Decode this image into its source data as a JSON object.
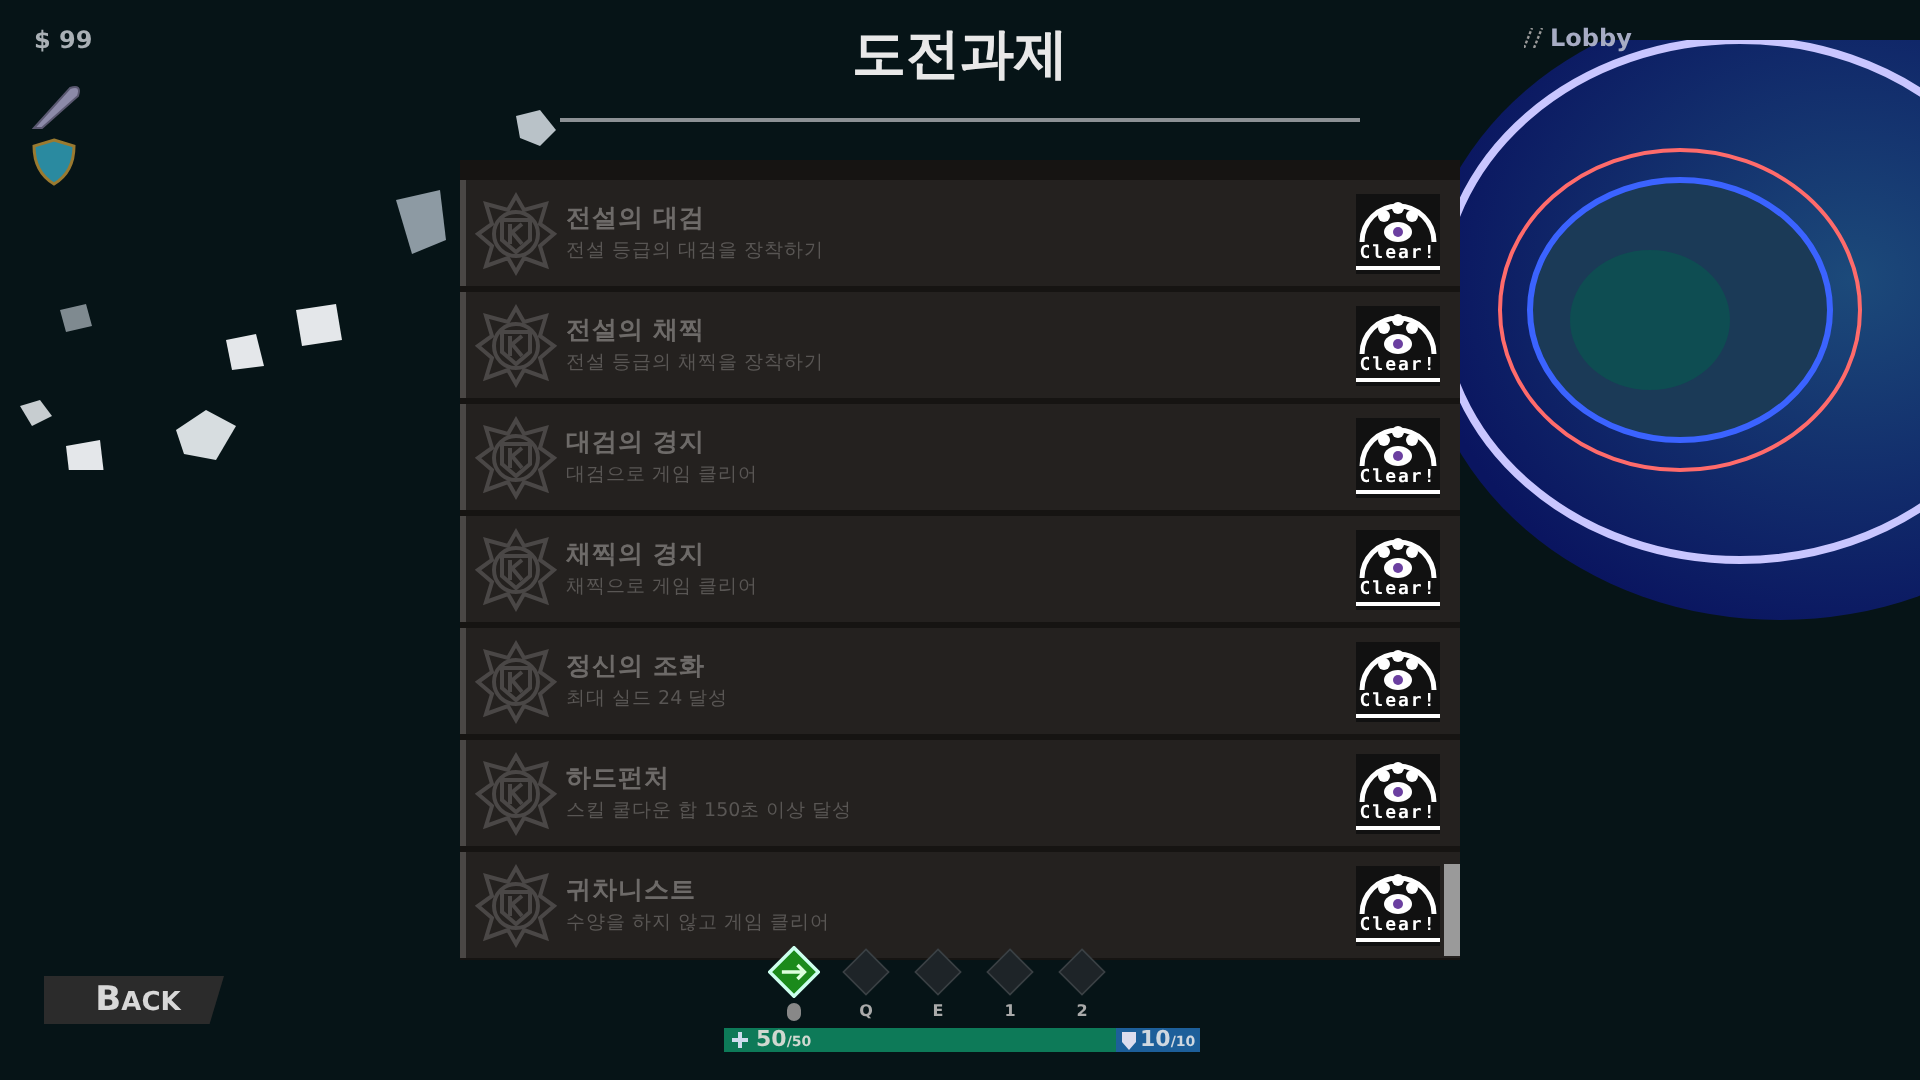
{
  "hud": {
    "money": "$ 99",
    "location": "Lobby"
  },
  "title": "도전과제",
  "achievements": [
    {
      "title": "전설의 대검",
      "description": "전설 등급의 대검을 장착하기",
      "badge": "Clear!"
    },
    {
      "title": "전설의 채찍",
      "description": "전설 등급의 채찍을 장착하기",
      "badge": "Clear!"
    },
    {
      "title": "대검의 경지",
      "description": "대검으로 게임 클리어",
      "badge": "Clear!"
    },
    {
      "title": "채찍의 경지",
      "description": "채찍으로 게임 클리어",
      "badge": "Clear!"
    },
    {
      "title": "정신의 조화",
      "description": "최대 실드 24 달성",
      "badge": "Clear!"
    },
    {
      "title": "하드펀처",
      "description": "스킬 쿨다운 합 150초 이상 달성",
      "badge": "Clear!"
    },
    {
      "title": "귀차니스트",
      "description": "수양을 하지 않고 게임 클리어",
      "badge": "Clear!"
    }
  ],
  "back_button": "BACK",
  "skills": [
    {
      "kind": "mouse",
      "equipped": true
    },
    {
      "key": "Q",
      "kind": "key",
      "equipped": false
    },
    {
      "key": "E",
      "kind": "key",
      "equipped": false
    },
    {
      "key": "1",
      "kind": "key",
      "equipped": false
    },
    {
      "key": "2",
      "kind": "key",
      "equipped": false
    }
  ],
  "health": {
    "value": "50",
    "max": "/50",
    "level": 1
  },
  "shield": {
    "value": "10",
    "max": "/10"
  }
}
